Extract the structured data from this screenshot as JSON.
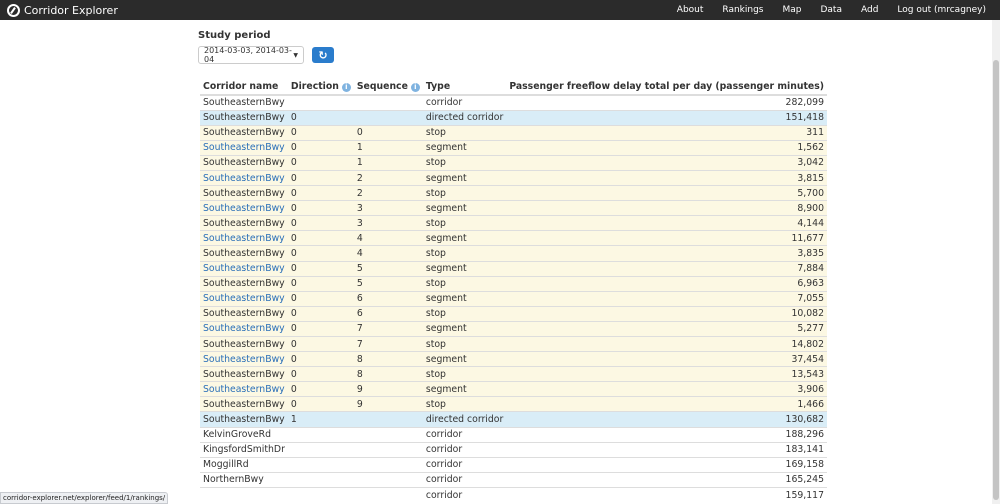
{
  "navbar": {
    "brand": "Corridor Explorer",
    "links": [
      "About",
      "Rankings",
      "Map",
      "Data",
      "Add",
      "Log out (mrcagney)"
    ]
  },
  "study": {
    "label": "Study period",
    "selected": "2014-03-03, 2014-03-04"
  },
  "table": {
    "columns": [
      "Corridor name",
      "Direction",
      "Sequence",
      "Type",
      "Passenger freeflow delay total per day (passenger minutes)"
    ],
    "rows": [
      {
        "name": "SoutheasternBwy",
        "direction": "",
        "sequence": "",
        "type": "corridor",
        "value": "282,099",
        "style": "",
        "link": false
      },
      {
        "name": "SoutheasternBwy",
        "direction": "0",
        "sequence": "",
        "type": "directed corridor",
        "value": "151,418",
        "style": "blue",
        "link": false
      },
      {
        "name": "SoutheasternBwy",
        "direction": "0",
        "sequence": "0",
        "type": "stop",
        "value": "311",
        "style": "cream",
        "link": false
      },
      {
        "name": "SoutheasternBwy",
        "direction": "0",
        "sequence": "1",
        "type": "segment",
        "value": "1,562",
        "style": "cream",
        "link": true
      },
      {
        "name": "SoutheasternBwy",
        "direction": "0",
        "sequence": "1",
        "type": "stop",
        "value": "3,042",
        "style": "cream",
        "link": false
      },
      {
        "name": "SoutheasternBwy",
        "direction": "0",
        "sequence": "2",
        "type": "segment",
        "value": "3,815",
        "style": "cream",
        "link": true
      },
      {
        "name": "SoutheasternBwy",
        "direction": "0",
        "sequence": "2",
        "type": "stop",
        "value": "5,700",
        "style": "cream",
        "link": false
      },
      {
        "name": "SoutheasternBwy",
        "direction": "0",
        "sequence": "3",
        "type": "segment",
        "value": "8,900",
        "style": "cream",
        "link": true
      },
      {
        "name": "SoutheasternBwy",
        "direction": "0",
        "sequence": "3",
        "type": "stop",
        "value": "4,144",
        "style": "cream",
        "link": false
      },
      {
        "name": "SoutheasternBwy",
        "direction": "0",
        "sequence": "4",
        "type": "segment",
        "value": "11,677",
        "style": "cream",
        "link": true
      },
      {
        "name": "SoutheasternBwy",
        "direction": "0",
        "sequence": "4",
        "type": "stop",
        "value": "3,835",
        "style": "cream",
        "link": false
      },
      {
        "name": "SoutheasternBwy",
        "direction": "0",
        "sequence": "5",
        "type": "segment",
        "value": "7,884",
        "style": "cream",
        "link": true
      },
      {
        "name": "SoutheasternBwy",
        "direction": "0",
        "sequence": "5",
        "type": "stop",
        "value": "6,963",
        "style": "cream",
        "link": false
      },
      {
        "name": "SoutheasternBwy",
        "direction": "0",
        "sequence": "6",
        "type": "segment",
        "value": "7,055",
        "style": "cream",
        "link": true
      },
      {
        "name": "SoutheasternBwy",
        "direction": "0",
        "sequence": "6",
        "type": "stop",
        "value": "10,082",
        "style": "cream",
        "link": false
      },
      {
        "name": "SoutheasternBwy",
        "direction": "0",
        "sequence": "7",
        "type": "segment",
        "value": "5,277",
        "style": "cream",
        "link": true
      },
      {
        "name": "SoutheasternBwy",
        "direction": "0",
        "sequence": "7",
        "type": "stop",
        "value": "14,802",
        "style": "cream",
        "link": false
      },
      {
        "name": "SoutheasternBwy",
        "direction": "0",
        "sequence": "8",
        "type": "segment",
        "value": "37,454",
        "style": "cream",
        "link": true
      },
      {
        "name": "SoutheasternBwy",
        "direction": "0",
        "sequence": "8",
        "type": "stop",
        "value": "13,543",
        "style": "cream",
        "link": false
      },
      {
        "name": "SoutheasternBwy",
        "direction": "0",
        "sequence": "9",
        "type": "segment",
        "value": "3,906",
        "style": "cream",
        "link": true
      },
      {
        "name": "SoutheasternBwy",
        "direction": "0",
        "sequence": "9",
        "type": "stop",
        "value": "1,466",
        "style": "cream",
        "link": false
      },
      {
        "name": "SoutheasternBwy",
        "direction": "1",
        "sequence": "",
        "type": "directed corridor",
        "value": "130,682",
        "style": "blue",
        "link": false
      },
      {
        "name": "KelvinGroveRd",
        "direction": "",
        "sequence": "",
        "type": "corridor",
        "value": "188,296",
        "style": "",
        "link": false
      },
      {
        "name": "KingsfordSmithDr",
        "direction": "",
        "sequence": "",
        "type": "corridor",
        "value": "183,141",
        "style": "",
        "link": false
      },
      {
        "name": "MoggillRd",
        "direction": "",
        "sequence": "",
        "type": "corridor",
        "value": "169,158",
        "style": "",
        "link": false
      },
      {
        "name": "NorthernBwy",
        "direction": "",
        "sequence": "",
        "type": "corridor",
        "value": "165,245",
        "style": "",
        "link": false
      },
      {
        "name": "",
        "direction": "",
        "sequence": "",
        "type": "corridor",
        "value": "159,117",
        "style": "",
        "link": false
      }
    ]
  },
  "statusbar": "corridor-explorer.net/explorer/feed/1/rankings/",
  "icons": {
    "brand": "compass-logo-icon",
    "refresh": "refresh-icon",
    "info": "info-icon",
    "select": "chevron-down-icon"
  },
  "colors": {
    "navbar": "#2b2b2b",
    "accent": "#2a7ccc",
    "link": "#2a6fb8",
    "row_blue": "#d9edf7",
    "row_cream": "#fcf8e3"
  }
}
